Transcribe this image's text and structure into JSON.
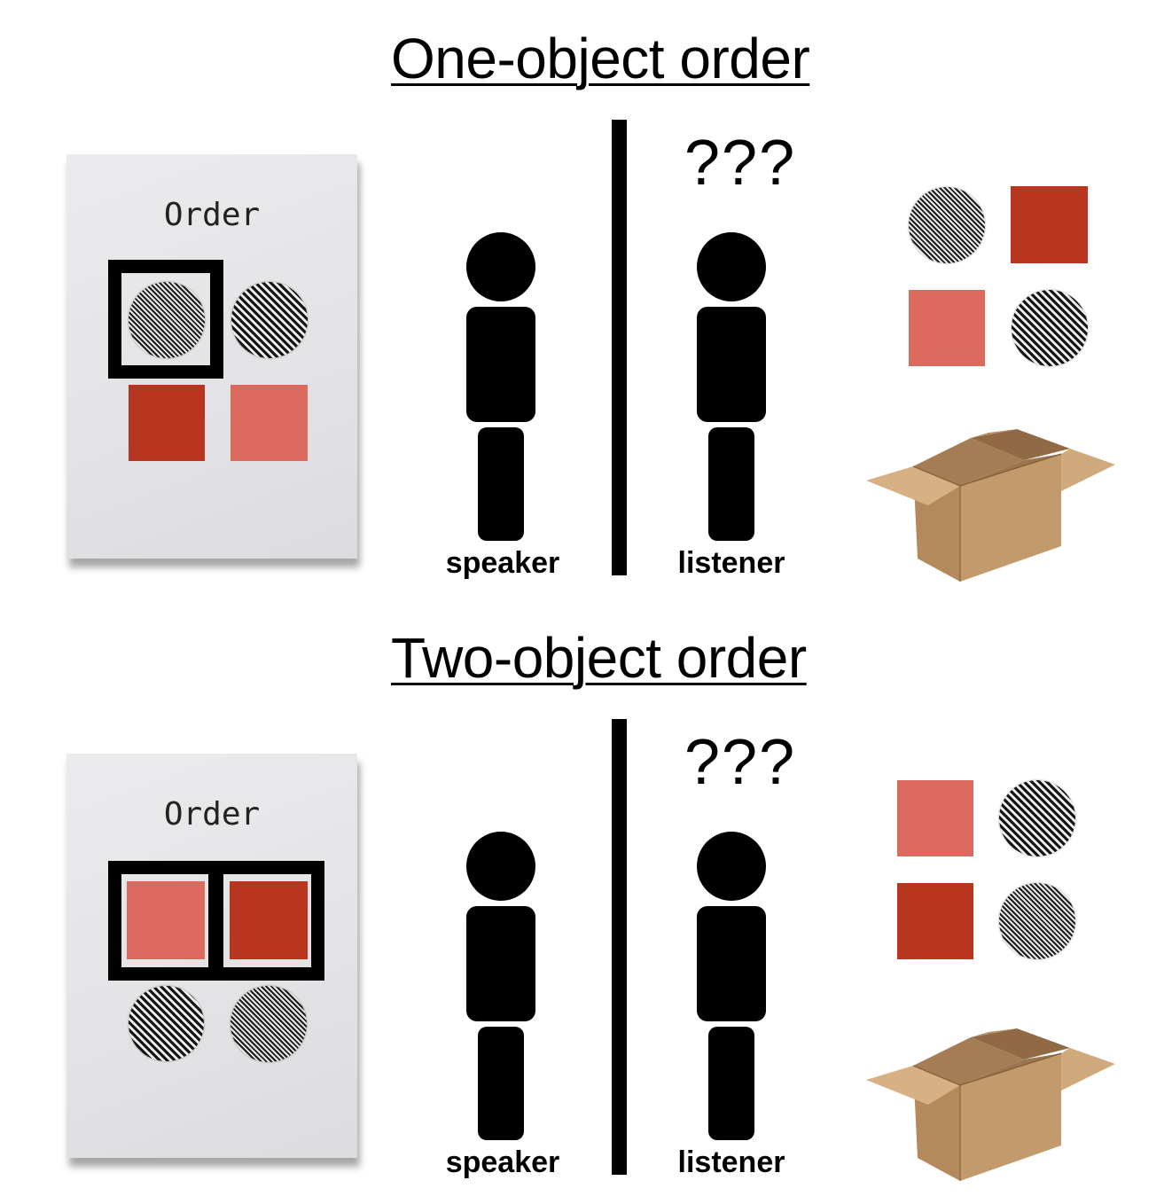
{
  "panels": [
    {
      "title": "One-object order",
      "paper_label": "Order",
      "speaker_label": "speaker",
      "listener_label": "listener",
      "confusion": "???",
      "order_items": [
        "striped-circle (selected)",
        "striped-circle",
        "dark-red-square",
        "light-red-square"
      ],
      "box_items": [
        "striped-circle",
        "dark-red-square",
        "light-red-square",
        "striped-circle"
      ]
    },
    {
      "title": "Two-object order",
      "paper_label": "Order",
      "speaker_label": "speaker",
      "listener_label": "listener",
      "confusion": "???",
      "order_items": [
        "light-red-square (selected)",
        "dark-red-square (selected)",
        "striped-circle",
        "striped-circle"
      ],
      "box_items": [
        "light-red-square",
        "striped-circle",
        "dark-red-square",
        "striped-circle"
      ]
    }
  ],
  "colors": {
    "dark_red": "#b8361f",
    "light_red": "#dc6a5e",
    "cardboard": "#c39a6b"
  }
}
